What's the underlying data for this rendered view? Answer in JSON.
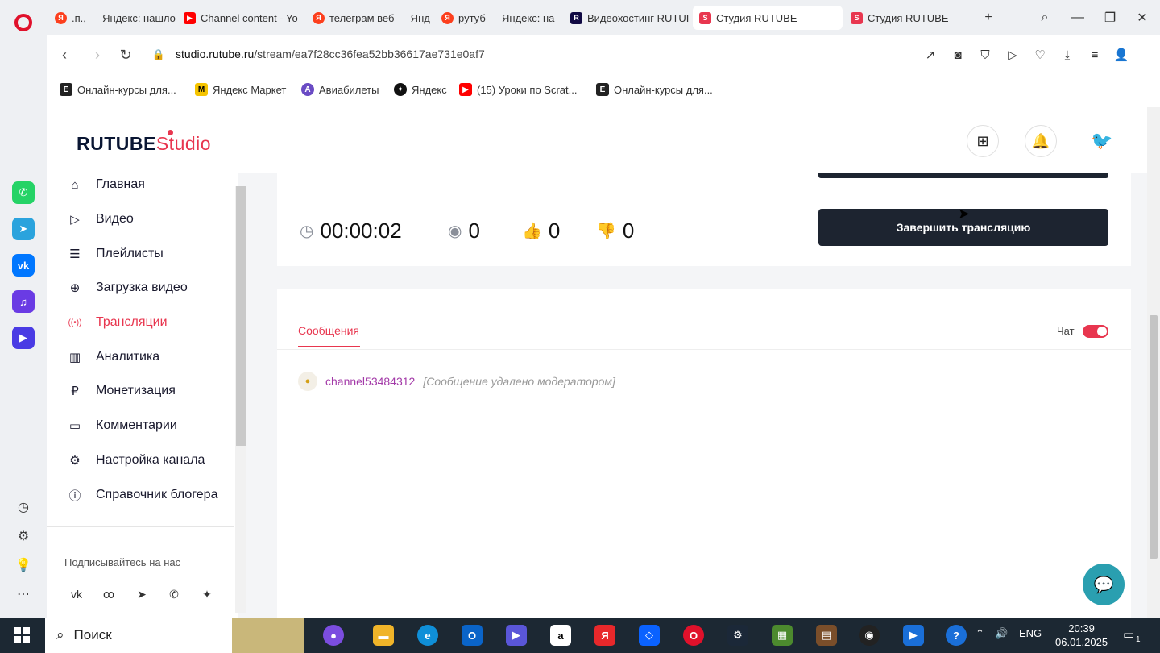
{
  "browser": {
    "tabs": [
      {
        "label": ".п., — Яндекс: нашло",
        "icon": "yandex-icon",
        "color": "#fc3f1d"
      },
      {
        "label": "Channel content - Yo",
        "icon": "youtube-icon",
        "color": "#ff0000"
      },
      {
        "label": "телеграм веб — Янд",
        "icon": "yandex-icon",
        "color": "#fc3f1d"
      },
      {
        "label": "рутуб — Яндекс: на",
        "icon": "yandex-icon",
        "color": "#fc3f1d"
      },
      {
        "label": "Видеохостинг RUTUI",
        "icon": "rutube-icon",
        "color": "#100943"
      },
      {
        "label": "Студия RUTUBE",
        "icon": "rutube-studio-icon",
        "color": "#e8364f"
      },
      {
        "label": "Студия RUTUBE",
        "icon": "rutube-studio-icon",
        "color": "#e8364f"
      }
    ],
    "active_tab": 5,
    "url_host": "studio.rutube.ru",
    "url_path": "/stream/ea7f28cc36fea52bb36617ae731e0af7",
    "bookmarks": [
      {
        "label": "Онлайн-курсы для...",
        "icon": "E",
        "color": "#222"
      },
      {
        "label": "Яндекс Маркет",
        "icon": "M",
        "color": "#f5c400"
      },
      {
        "label": "Авиабилеты",
        "icon": "A",
        "color": "#6a4bc4"
      },
      {
        "label": "Яндекс",
        "icon": "✦",
        "color": "#111"
      },
      {
        "label": "(15) Уроки по Scrat...",
        "icon": "▶",
        "color": "#ff0000"
      },
      {
        "label": "Онлайн-курсы для...",
        "icon": "E",
        "color": "#222"
      }
    ]
  },
  "studio": {
    "logo_main": "RUTUBE",
    "logo_sub": "Studio",
    "nav": [
      {
        "label": "Главная",
        "icon": "home-icon",
        "glyph": "⌂"
      },
      {
        "label": "Видео",
        "icon": "video-icon",
        "glyph": "▷"
      },
      {
        "label": "Плейлисты",
        "icon": "playlist-icon",
        "glyph": "☰"
      },
      {
        "label": "Загрузка видео",
        "icon": "upload-icon",
        "glyph": "⊕"
      },
      {
        "label": "Трансляции",
        "icon": "broadcast-icon",
        "glyph": "((•))"
      },
      {
        "label": "Аналитика",
        "icon": "analytics-icon",
        "glyph": "▥"
      },
      {
        "label": "Монетизация",
        "icon": "ruble-icon",
        "glyph": "₽"
      },
      {
        "label": "Комментарии",
        "icon": "comment-icon",
        "glyph": "▭"
      },
      {
        "label": "Настройка канала",
        "icon": "gear-icon",
        "glyph": "⚙"
      },
      {
        "label": "Справочник блогера",
        "icon": "info-icon",
        "glyph": "ⓘ"
      }
    ],
    "active_nav": 4,
    "follow_label": "Подписывайтесь на нас",
    "stats": {
      "duration": "00:00:02",
      "viewers": "0",
      "likes": "0",
      "dislikes": "0"
    },
    "end_button": "Завершить трансляцию",
    "chat": {
      "tab_label": "Сообщения",
      "toggle_label": "Чат",
      "enabled": true,
      "messages": [
        {
          "user": "channel53484312",
          "text": "[Сообщение удалено модератором]"
        }
      ]
    }
  },
  "taskbar": {
    "search_label": "Поиск",
    "lang": "ENG",
    "time": "20:39",
    "date": "06.01.2025",
    "notification_count": "1"
  }
}
